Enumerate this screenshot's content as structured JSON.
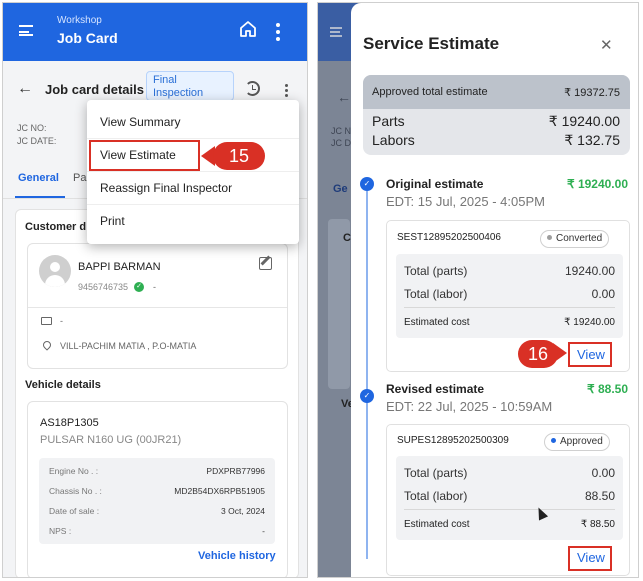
{
  "left_screen": {
    "app_bar": {
      "subtitle": "Workshop",
      "title": "Job Card"
    },
    "job_card": {
      "title": "Job card details",
      "status": "Final Inspection",
      "jc_no_label": "JC NO:",
      "jc_date_label": "JC DATE:"
    },
    "tabs": [
      "General",
      "Pa"
    ],
    "customer": {
      "section_title": "Customer d",
      "name": "BAPPI BARMAN",
      "phone": "9456746735",
      "phone_suffix": "-",
      "email": "-",
      "address": "VILL-PACHIM MATIA , P.O-MATIA"
    },
    "vehicle": {
      "section_title": "Vehicle details",
      "reg_no": "AS18P1305",
      "model": "PULSAR N160 UG (00JR21)",
      "specs": [
        {
          "label": "Engine No . :",
          "value": "PDXPRB77996"
        },
        {
          "label": "Chassis No . :",
          "value": "MD2B54DX6RPB51905"
        },
        {
          "label": "Date of sale :",
          "value": "3 Oct, 2024"
        },
        {
          "label": "NPS :",
          "value": "-"
        }
      ],
      "history_link": "Vehicle history"
    },
    "menu": {
      "items": [
        "View Summary",
        "View Estimate",
        "Reassign Final Inspector",
        "Print"
      ]
    },
    "step_badge": "15"
  },
  "right_screen": {
    "background": {
      "jc_no_label": "JC N",
      "jc_date_label": "JC D",
      "tab": "Ge",
      "card_letter": "C",
      "vehicle_letters": "Ve"
    },
    "sheet": {
      "title": "Service Estimate",
      "close_icon": "close-icon",
      "summary": {
        "approved_label": "Approved total estimate",
        "approved_value": "₹ 19372.75",
        "parts_label": "Parts",
        "parts_value": "₹ 19240.00",
        "labors_label": "Labors",
        "labors_value": "₹ 132.75"
      },
      "estimates": [
        {
          "title": "Original estimate",
          "amount": "₹ 19240.00",
          "edt": "EDT: 15 Jul, 2025 - 4:05PM",
          "code": "SEST12895202500406",
          "status": "Converted",
          "status_color": "#9e9e9e",
          "total_parts_label": "Total (parts)",
          "total_parts": "19240.00",
          "total_labor_label": "Total (labor)",
          "total_labor": "0.00",
          "estimated_cost_label": "Estimated cost",
          "estimated_cost": "₹ 19240.00",
          "view_label": "View"
        },
        {
          "title": "Revised estimate",
          "amount": "₹ 88.50",
          "edt": "EDT: 22 Jul, 2025 - 10:59AM",
          "code": "SUPES12895202500309",
          "status": "Approved",
          "status_color": "#1f66e0",
          "total_parts_label": "Total (parts)",
          "total_parts": "0.00",
          "total_labor_label": "Total (labor)",
          "total_labor": "88.50",
          "estimated_cost_label": "Estimated cost",
          "estimated_cost": "₹ 88.50",
          "view_label": "View"
        }
      ]
    },
    "step_badge": "16"
  },
  "colors": {
    "primary": "#1f66e0",
    "success": "#2eaf52",
    "annotation_red": "#d93025"
  }
}
